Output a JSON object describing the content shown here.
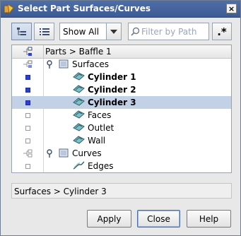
{
  "window": {
    "title": "Select Part Surfaces/Curves",
    "close_label": "×"
  },
  "toolbar": {
    "show_select": "Show All",
    "filter_placeholder": "Filter by Path",
    "regex_label": ".*"
  },
  "tree": {
    "header": "Parts > Baffle 1",
    "rows": [
      {
        "label": "Surfaces",
        "kind": "folder"
      },
      {
        "label": "Cylinder 1",
        "kind": "surface",
        "bold": true,
        "checked": true
      },
      {
        "label": "Cylinder 2",
        "kind": "surface",
        "bold": true,
        "checked": true
      },
      {
        "label": "Cylinder 3",
        "kind": "surface",
        "bold": true,
        "checked": true,
        "selected": true
      },
      {
        "label": "Faces",
        "kind": "surface",
        "checked": false
      },
      {
        "label": "Outlet",
        "kind": "surface",
        "checked": false
      },
      {
        "label": "Wall",
        "kind": "surface",
        "checked": false
      },
      {
        "label": "Curves",
        "kind": "folder"
      },
      {
        "label": "Edges",
        "kind": "curve",
        "checked": false
      }
    ]
  },
  "status": {
    "path": "Surfaces > Cylinder 3"
  },
  "buttons": {
    "apply": "Apply",
    "close": "Close",
    "help": "Help"
  },
  "colors": {
    "title_bar": "#3f5d96",
    "selection": "#c3d1e6",
    "checked": "#2a3fd6"
  }
}
